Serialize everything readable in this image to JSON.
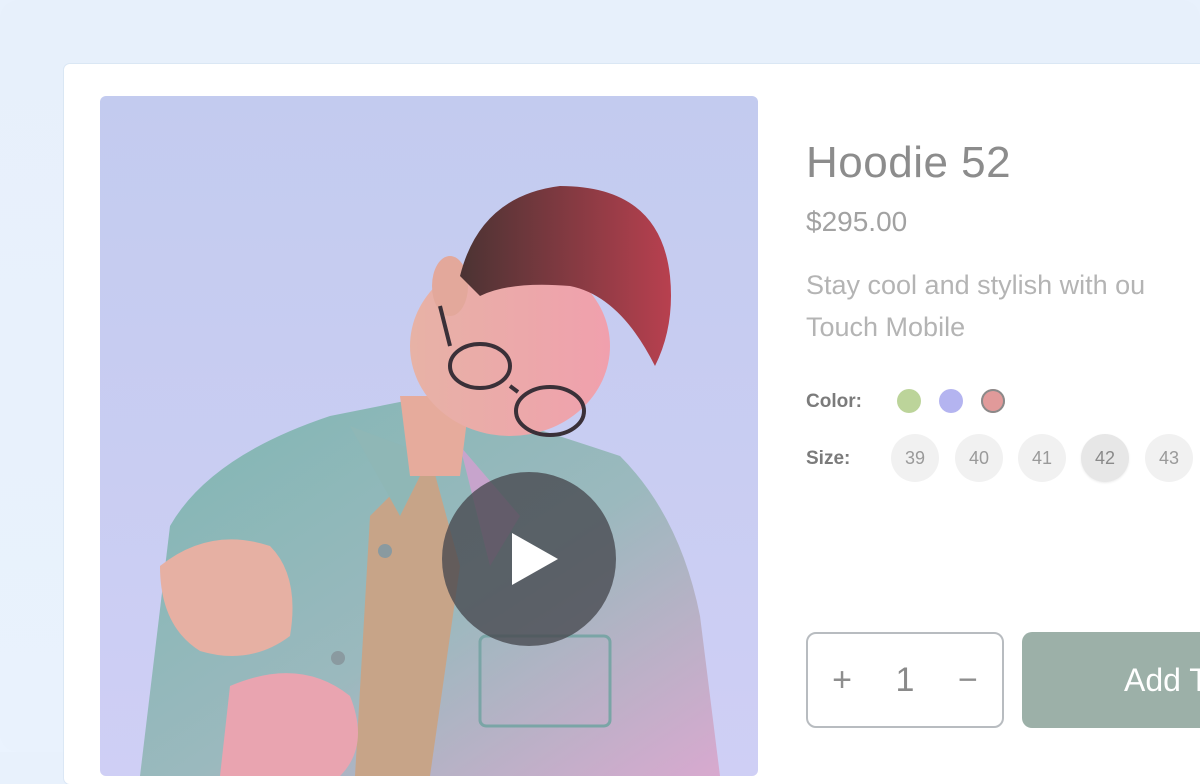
{
  "product": {
    "title": "Hoodie 52",
    "price": "$295.00",
    "description_lines": [
      "Stay cool and stylish with ou",
      "Touch Mobile"
    ]
  },
  "options": {
    "color_label": "Color:",
    "colors": [
      {
        "name": "green",
        "hex": "#bcd49a",
        "selected": false
      },
      {
        "name": "lavender",
        "hex": "#b4b4f0",
        "selected": false
      },
      {
        "name": "rose",
        "hex": "#e19a9a",
        "selected": true
      }
    ],
    "size_label": "Size:",
    "sizes": [
      {
        "label": "39",
        "selected": false
      },
      {
        "label": "40",
        "selected": false
      },
      {
        "label": "41",
        "selected": false
      },
      {
        "label": "42",
        "selected": true
      },
      {
        "label": "43",
        "selected": false
      }
    ]
  },
  "purchase": {
    "increment_glyph": "+",
    "quantity": "1",
    "decrement_glyph": "−",
    "add_label": "Add T"
  },
  "media": {
    "play_icon": "play-icon"
  }
}
